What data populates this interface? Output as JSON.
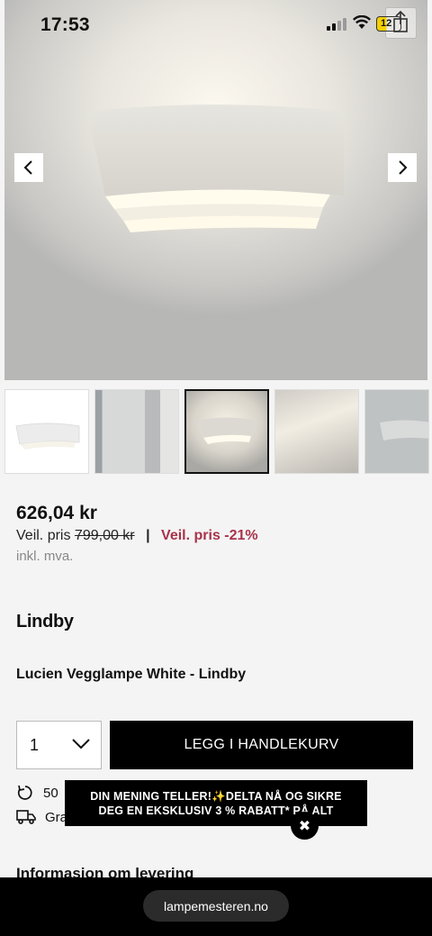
{
  "status_bar": {
    "time": "17:53",
    "battery": "12"
  },
  "gallery": {
    "prev_icon": "chevron-left-icon",
    "next_icon": "chevron-right-icon",
    "thumbnail_count": 5,
    "active_thumbnail": 3
  },
  "product": {
    "price": "626,04 kr",
    "rrp_label": "Veil. pris",
    "rrp_value": "799,00 kr",
    "separator": "|",
    "discount": "Veil. pris -21%",
    "vat_note": "inkl. mva.",
    "brand": "Lindby",
    "name": "Lucien Vegglampe White - Lindby"
  },
  "purchase": {
    "quantity": "1",
    "add_to_cart": "LEGG I HANDLEKURV"
  },
  "info": {
    "return_text": "50",
    "shipping_text": "Gra"
  },
  "promo": {
    "line1": "DIN MENING TELLER!✨DELTA NÅ OG SIKRE",
    "line2": "DEG EN EKSKLUSIV 3 % RABATT* PÅ ALT",
    "close": "✖"
  },
  "delivery_heading": "Informasjon om levering",
  "browser": {
    "url": "lampemesteren.no"
  },
  "colors": {
    "discount": "#a8324a",
    "button": "#000000",
    "background": "#f4f4f4"
  }
}
